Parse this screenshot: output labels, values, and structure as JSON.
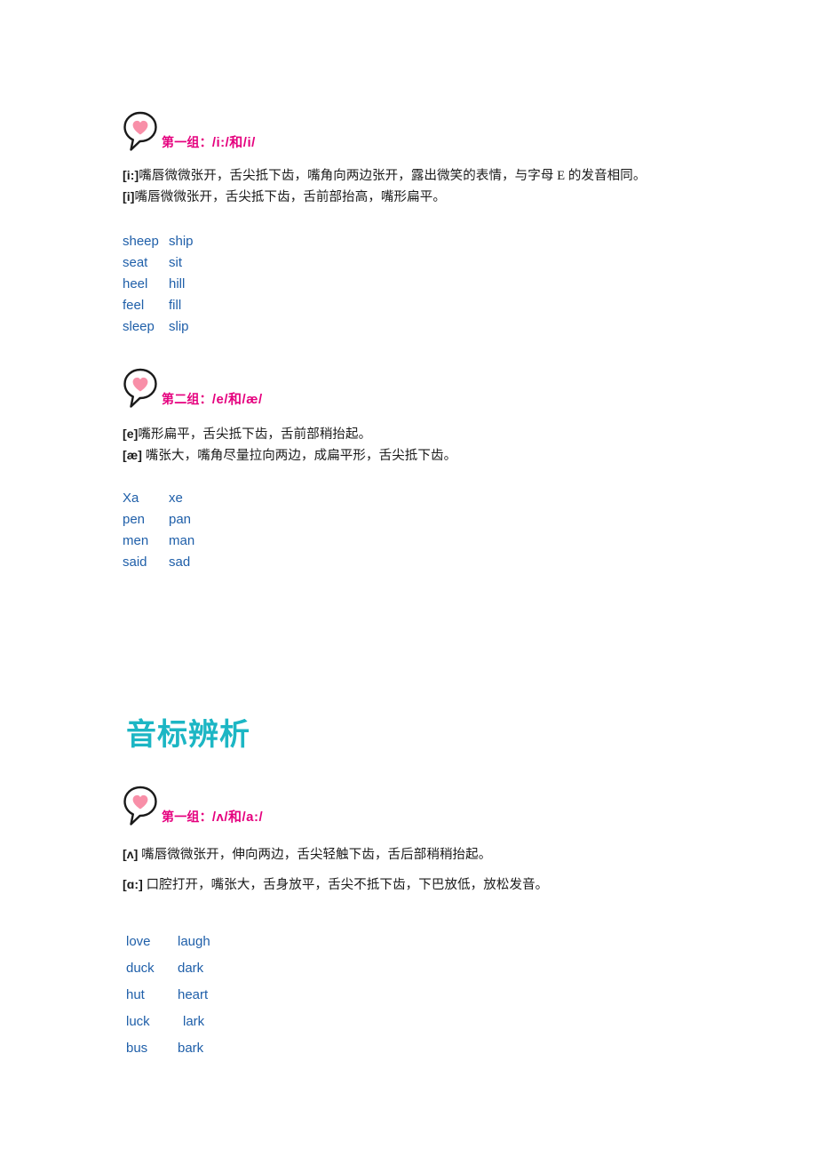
{
  "page": {
    "background": "#ffffff",
    "accent_pink": "#e5007e",
    "accent_blue": "#1f5fa9",
    "accent_teal": "#1cb6c4",
    "text_color": "#1a1a1a"
  },
  "banner": {
    "title": "音标辨析"
  },
  "sections": [
    {
      "id": "group-1-i",
      "icon": "heart-speech-bubble-icon",
      "title_prefix": "第一组：",
      "title_ipa": "/i:/和/i/",
      "descriptions": [
        {
          "symbol": "[i:]",
          "text": "嘴唇微微张开，舌尖抵下齿，嘴角向两边张开，露出微笑的表情，与字母 E 的发音相同。"
        },
        {
          "symbol": "[i]",
          "text": "嘴唇微微张开，舌尖抵下齿，舌前部抬高，嘴形扁平。"
        }
      ],
      "words": [
        {
          "left": "sheep",
          "right": "ship"
        },
        {
          "left": "seat",
          "right": "sit"
        },
        {
          "left": "heel",
          "right": "hill"
        },
        {
          "left": "feel",
          "right": "fill"
        },
        {
          "left": "sleep",
          "right": "slip"
        }
      ]
    },
    {
      "id": "group-2-e",
      "icon": "heart-speech-bubble-icon",
      "title_prefix": "第二组：",
      "title_ipa": "/e/和/æ/",
      "descriptions": [
        {
          "symbol": "[e]",
          "text": "嘴形扁平，舌尖抵下齿，舌前部稍抬起。"
        },
        {
          "symbol": "[æ]",
          "text": " 嘴张大，嘴角尽量拉向两边，成扁平形，舌尖抵下齿。"
        }
      ],
      "words": [
        {
          "left": "Xa",
          "right": "xe"
        },
        {
          "left": "pen",
          "right": "pan"
        },
        {
          "left": "men",
          "right": "man"
        },
        {
          "left": "said",
          "right": "sad"
        }
      ]
    },
    {
      "id": "group-3-schwa",
      "icon": "heart-speech-bubble-icon",
      "title_prefix": "第一组：",
      "title_ipa": "/ʌ/和/a:/",
      "descriptions": [
        {
          "symbol": "[ʌ]",
          "text": " 嘴唇微微张开，伸向两边，舌尖轻触下齿，舌后部稍稍抬起。"
        },
        {
          "symbol": "[ɑ:]",
          "text": " 口腔打开，嘴张大，舌身放平，舌尖不抵下齿，下巴放低，放松发音。"
        }
      ],
      "words": [
        {
          "left": "love",
          "right": "laugh"
        },
        {
          "left": "duck",
          "right": "dark"
        },
        {
          "left": "hut",
          "right": "heart"
        },
        {
          "left": "luck",
          "right": "lark"
        },
        {
          "left": "bus",
          "right": "bark"
        }
      ]
    }
  ]
}
